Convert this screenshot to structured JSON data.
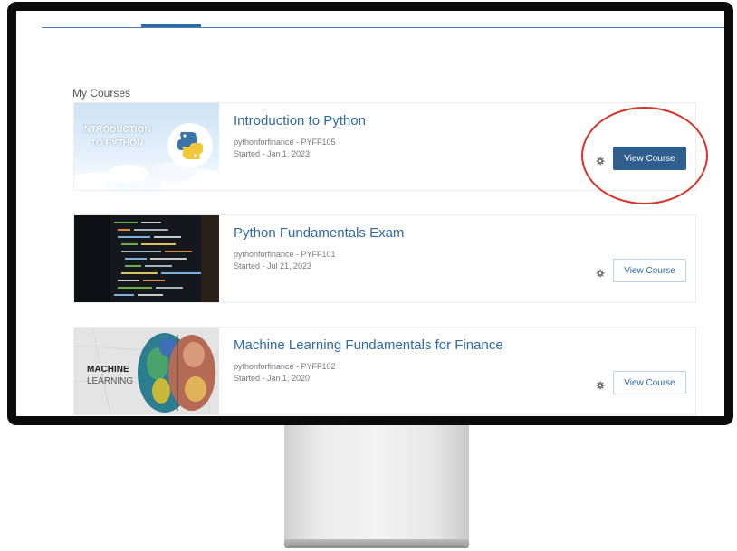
{
  "section_title": "My Courses",
  "colors": {
    "accent": "#2f6aa3",
    "primary_button": "#2e5f8f",
    "highlight": "#d8312b"
  },
  "courses": [
    {
      "title": "Introduction to Python",
      "provider_code": "pythonforfinance - PYFF105",
      "started": "Started - Jan 1, 2023",
      "thumb_text_1": "INTRODUCTION",
      "thumb_text_2": "TO PYTHON",
      "settings_icon": "gear-icon",
      "button_label": "View Course",
      "button_style": "primary"
    },
    {
      "title": "Python Fundamentals Exam",
      "provider_code": "pythonforfinance - PYFF101",
      "started": "Started - Jul 21, 2023",
      "settings_icon": "gear-icon",
      "button_label": "View Course",
      "button_style": "outline"
    },
    {
      "title": "Machine Learning Fundamentals for Finance",
      "provider_code": "pythonforfinance - PYFF102",
      "started": "Started - Jan 1, 2020",
      "thumb_text_1": "MACHINE",
      "thumb_text_2": "LEARNING",
      "settings_icon": "gear-icon",
      "button_label": "View Course",
      "button_style": "outline"
    }
  ]
}
